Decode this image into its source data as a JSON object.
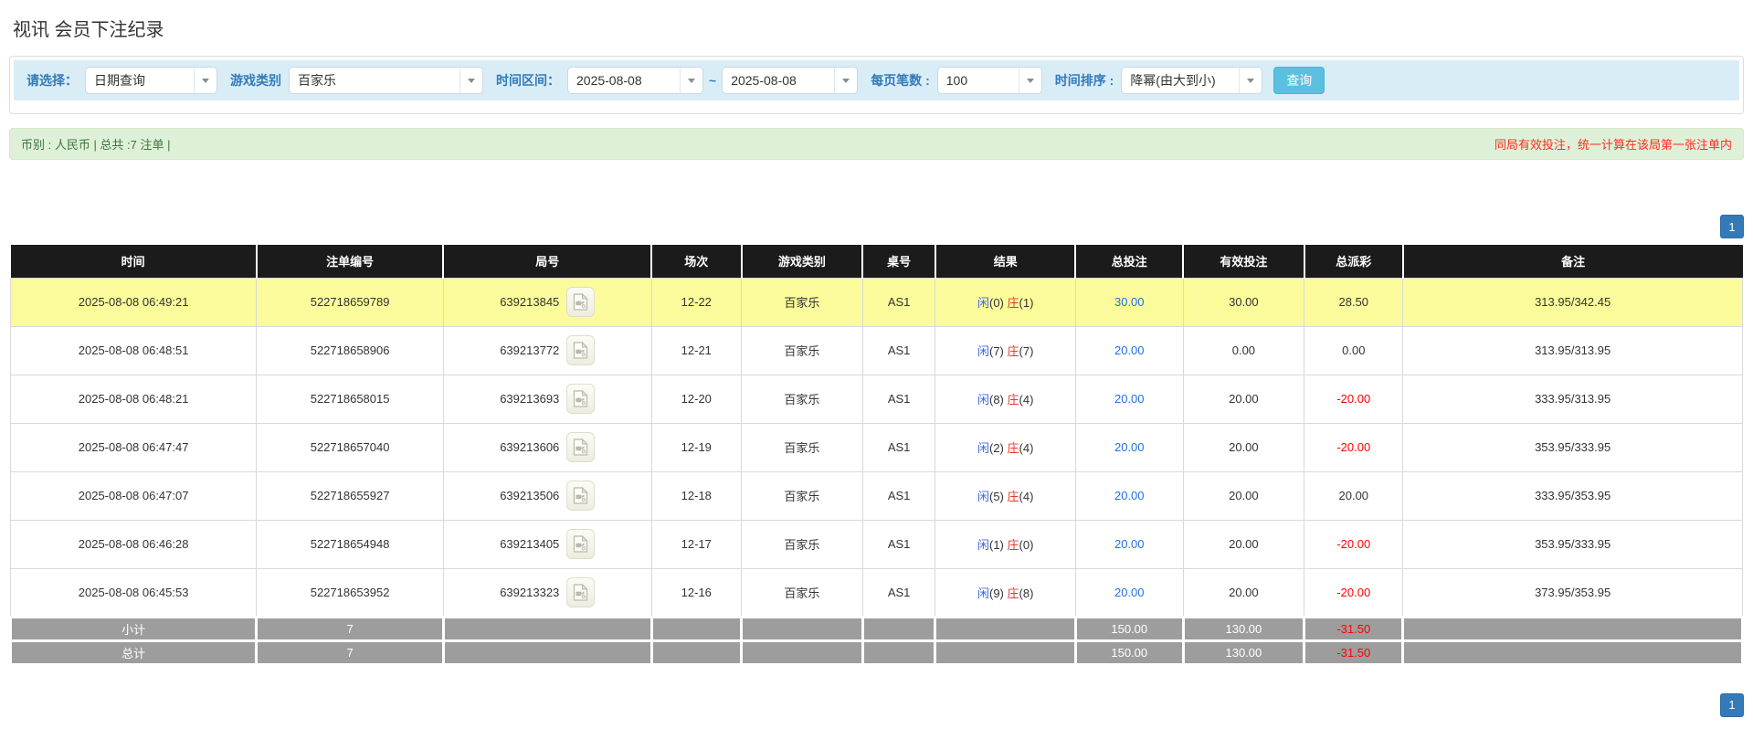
{
  "page": {
    "title": "视讯 会员下注纪录"
  },
  "colors": {
    "header_bg": "#1b1b1b",
    "highlight_yellow": "#fbfb9b",
    "summary_gray": "#9d9d9d",
    "link_blue": "#2170e8",
    "player_blue": "#4169e1",
    "banker_red": "#e8372c",
    "negative_red": "#ff0000",
    "notice_red": "#ff2d21",
    "filter_bg": "#d9edf7",
    "filter_label_blue": "#337ab7",
    "search_button_blue": "#5bc0de",
    "pagination_blue": "#337ab7",
    "success_bg": "#dff0d8",
    "success_text": "#3c763d"
  },
  "filters": {
    "select_label": "请选择：",
    "select_value": "日期查询",
    "game_type_label": "游戏类别",
    "game_type_value": "百家乐",
    "date_range_label": "时间区间：",
    "date_from": "2025-08-08",
    "tilde": "~",
    "date_to": "2025-08-08",
    "page_size_label": "每页笔数 :",
    "page_size_value": "100",
    "sort_label": "时间排序 :",
    "sort_value": "降幂(由大到小)",
    "search_button": "查询"
  },
  "summary": {
    "left": "币别 : 人民币 | 总共 :7 注单 |",
    "right_notice": "同局有效投注，统一计算在该局第一张注单内"
  },
  "pagination": {
    "page": "1"
  },
  "table": {
    "headers": [
      "时间",
      "注单编号",
      "局号",
      "场次",
      "游戏类别",
      "桌号",
      "结果",
      "总投注",
      "有效投注",
      "总派彩",
      "备注"
    ],
    "rows": [
      {
        "time": "2025-08-08 06:49:21",
        "bet_id": "522718659789",
        "round_id": "639213845",
        "session": "12-22",
        "game": "百家乐",
        "table_no": "AS1",
        "result_player": "闲(0)",
        "result_banker": "庄(1)",
        "total_bet": "30.00",
        "valid_bet": "30.00",
        "payout": "28.50",
        "remark": "313.95/342.45",
        "highlight": true
      },
      {
        "time": "2025-08-08 06:48:51",
        "bet_id": "522718658906",
        "round_id": "639213772",
        "session": "12-21",
        "game": "百家乐",
        "table_no": "AS1",
        "result_player": "闲(7)",
        "result_banker": "庄(7)",
        "total_bet": "20.00",
        "valid_bet": "0.00",
        "payout": "0.00",
        "remark": "313.95/313.95",
        "highlight": false
      },
      {
        "time": "2025-08-08 06:48:21",
        "bet_id": "522718658015",
        "round_id": "639213693",
        "session": "12-20",
        "game": "百家乐",
        "table_no": "AS1",
        "result_player": "闲(8)",
        "result_banker": "庄(4)",
        "total_bet": "20.00",
        "valid_bet": "20.00",
        "payout": "-20.00",
        "remark": "333.95/313.95",
        "highlight": false
      },
      {
        "time": "2025-08-08 06:47:47",
        "bet_id": "522718657040",
        "round_id": "639213606",
        "session": "12-19",
        "game": "百家乐",
        "table_no": "AS1",
        "result_player": "闲(2)",
        "result_banker": "庄(4)",
        "total_bet": "20.00",
        "valid_bet": "20.00",
        "payout": "-20.00",
        "remark": "353.95/333.95",
        "highlight": false
      },
      {
        "time": "2025-08-08 06:47:07",
        "bet_id": "522718655927",
        "round_id": "639213506",
        "session": "12-18",
        "game": "百家乐",
        "table_no": "AS1",
        "result_player": "闲(5)",
        "result_banker": "庄(4)",
        "total_bet": "20.00",
        "valid_bet": "20.00",
        "payout": "20.00",
        "remark": "333.95/353.95",
        "highlight": false
      },
      {
        "time": "2025-08-08 06:46:28",
        "bet_id": "522718654948",
        "round_id": "639213405",
        "session": "12-17",
        "game": "百家乐",
        "table_no": "AS1",
        "result_player": "闲(1)",
        "result_banker": "庄(0)",
        "total_bet": "20.00",
        "valid_bet": "20.00",
        "payout": "-20.00",
        "remark": "353.95/333.95",
        "highlight": false
      },
      {
        "time": "2025-08-08 06:45:53",
        "bet_id": "522718653952",
        "round_id": "639213323",
        "session": "12-16",
        "game": "百家乐",
        "table_no": "AS1",
        "result_player": "闲(9)",
        "result_banker": "庄(8)",
        "total_bet": "20.00",
        "valid_bet": "20.00",
        "payout": "-20.00",
        "remark": "373.95/353.95",
        "highlight": false
      }
    ],
    "subtotal": {
      "label": "小计",
      "count": "7",
      "total_bet": "150.00",
      "valid_bet": "130.00",
      "payout": "-31.50"
    },
    "total": {
      "label": "总计",
      "count": "7",
      "total_bet": "150.00",
      "valid_bet": "130.00",
      "payout": "-31.50"
    }
  }
}
